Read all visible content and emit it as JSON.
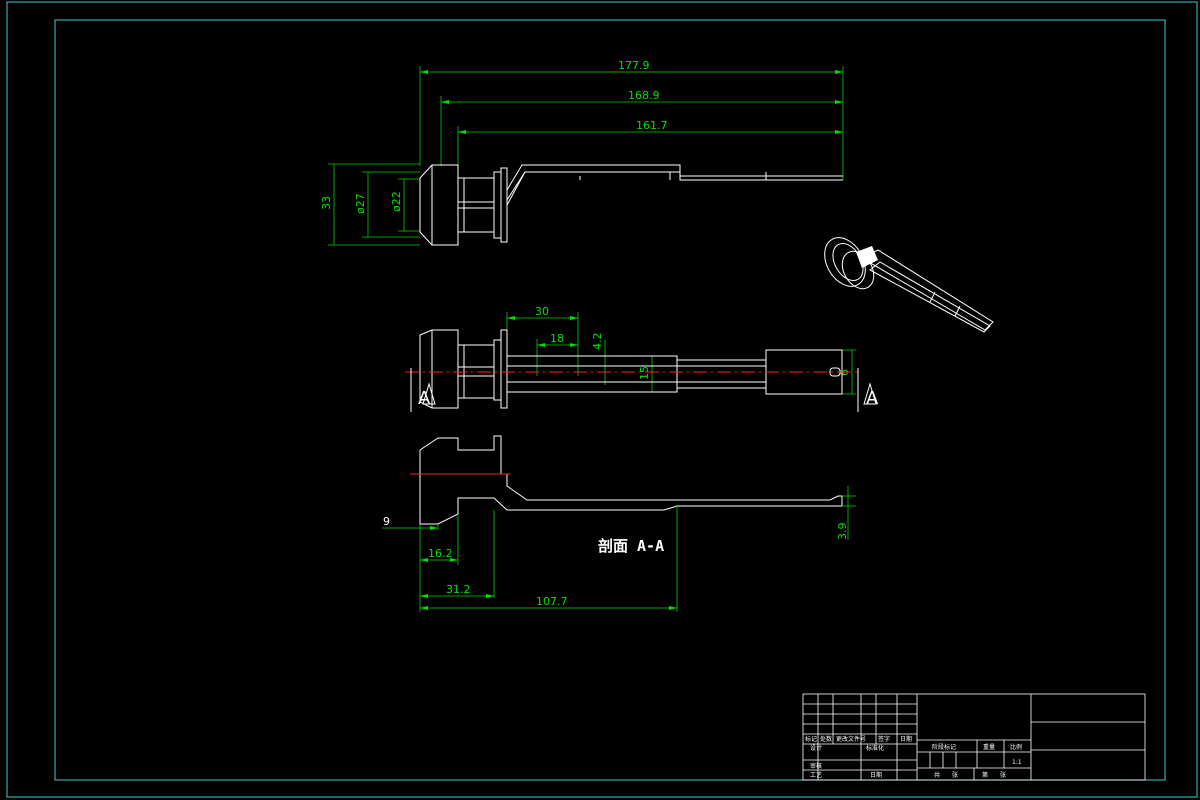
{
  "colors": {
    "background": "#000000",
    "border": "#3fd0d0",
    "outline": "#ffffff",
    "dimension": "#00e000",
    "centerline": "#ff2020",
    "hatch": "#a08a30"
  },
  "top_view": {
    "dims": {
      "overall_length": "177.9",
      "length_2": "168.9",
      "length_3": "161.7",
      "height": "33",
      "diameter_outer": "ø27",
      "diameter_inner": "ø22"
    }
  },
  "front_view": {
    "dims": {
      "d30": "30",
      "d18": "18",
      "d4_2": "4.2",
      "d15": "15",
      "d6": "6"
    },
    "section_marker_left": "A",
    "section_marker_right": "A"
  },
  "section_view": {
    "title": "剖面 A-A",
    "dims": {
      "d9": "9",
      "d16_2": "16.2",
      "d31_2": "31.2",
      "d107_7": "107.7",
      "d3_9": "3.9"
    }
  },
  "title_block": {
    "labels": [
      "标记",
      "处数",
      "更改文件号",
      "签字",
      "日期",
      "设计",
      "标准化",
      "审核",
      "工艺",
      "日期",
      "阶段标记",
      "重量",
      "比例",
      "1:1",
      "共",
      "张",
      "第",
      "张"
    ]
  }
}
